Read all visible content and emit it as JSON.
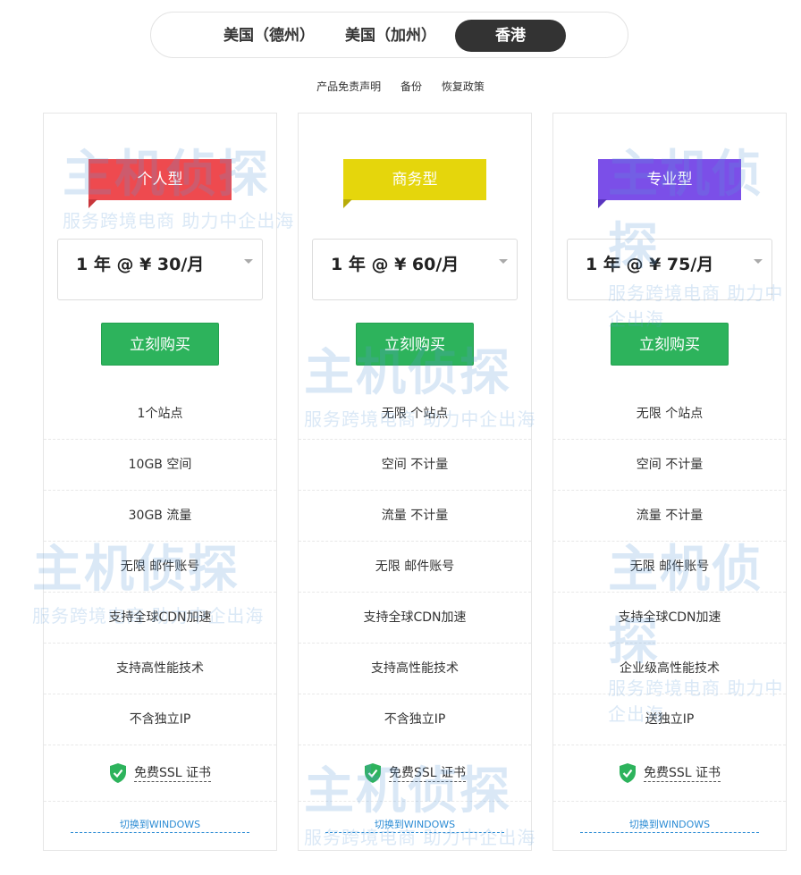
{
  "region_tabs": [
    {
      "label": "美国（德州）"
    },
    {
      "label": "美国（加州）"
    },
    {
      "label": "香港"
    }
  ],
  "sublinks": [
    "产品免责声明",
    "备份",
    "恢复政策"
  ],
  "colors": {
    "personal": "#ee4a4f",
    "business": "#e5d60c",
    "pro": "#7b4fe8",
    "buy": "#2db35c",
    "link": "#2a8bd4"
  },
  "watermark": {
    "brand": "主机侦探",
    "slogan": "服务跨境电商 助力中企出海"
  },
  "plans": [
    {
      "name": "个人型",
      "price": "1 年 @ ¥ 30/月",
      "buy": "立刻购买",
      "features": [
        "1个站点",
        "10GB 空间",
        "30GB 流量",
        "无限 邮件账号",
        "支持全球CDN加速",
        "支持高性能技术",
        "不含独立IP"
      ],
      "ssl": "免费SSL 证书",
      "switch": "切换到WINDOWS"
    },
    {
      "name": "商务型",
      "price": "1 年 @ ¥ 60/月",
      "buy": "立刻购买",
      "features": [
        "无限 个站点",
        "空间 不计量",
        "流量 不计量",
        "无限 邮件账号",
        "支持全球CDN加速",
        "支持高性能技术",
        "不含独立IP"
      ],
      "ssl": "免费SSL 证书",
      "switch": "切换到WINDOWS"
    },
    {
      "name": "专业型",
      "price": "1 年 @ ¥ 75/月",
      "buy": "立刻购买",
      "features": [
        "无限 个站点",
        "空间 不计量",
        "流量 不计量",
        "无限 邮件账号",
        "支持全球CDN加速",
        "企业级高性能技术",
        "送独立IP"
      ],
      "ssl": "免费SSL 证书",
      "switch": "切换到WINDOWS"
    }
  ]
}
